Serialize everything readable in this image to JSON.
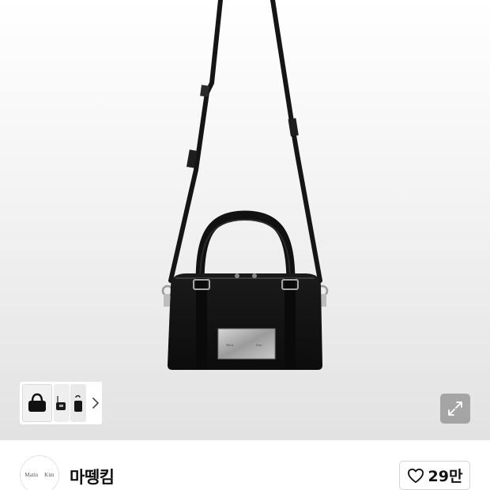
{
  "product": {
    "image_alt": "black mini bowling bag with long shoulder strap",
    "plate_text_left": "Matin",
    "plate_text_right": "Kim"
  },
  "gallery": {
    "next_icon": "chevron-right-icon",
    "expand_icon": "expand-icon"
  },
  "brand": {
    "logo_left": "Matin",
    "logo_right": "Kim",
    "name": "마뗑킴"
  },
  "like": {
    "icon": "heart-icon",
    "count": "29만"
  }
}
